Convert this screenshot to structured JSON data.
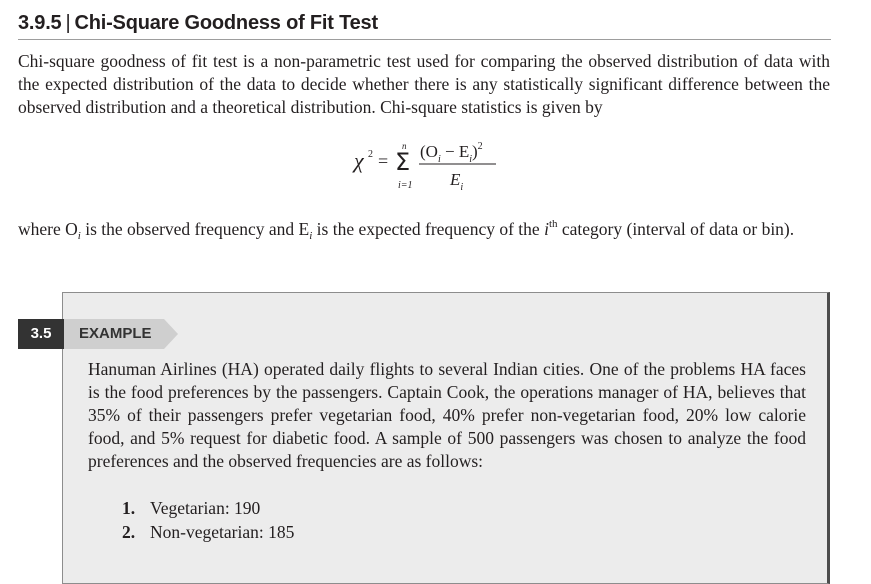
{
  "section": {
    "number": "3.9.5",
    "separator": "|",
    "title": "Chi-Square Goodness of Fit Test"
  },
  "intro_paragraph": "Chi-square goodness of fit test is a non-parametric test used for comparing the observed distribution of data with the expected distribution of the data to decide whether there is any statistically significant difference between the observed distribution and a theoretical distribution. Chi-square statistics is given by",
  "formula": {
    "lhs": "χ",
    "lhs_power": "2",
    "equals": "=",
    "sum_symbol": "Σ",
    "sum_upper": "n",
    "sum_lower": "i=1",
    "numerator": "(O",
    "numerator_sub1": "i",
    "numerator_mid": " − E",
    "numerator_sub2": "i",
    "numerator_close": ")",
    "numerator_power": "2",
    "denominator": "E",
    "denominator_sub": "i"
  },
  "where_paragraph": {
    "part1": "where O",
    "sub1": "i",
    "part2": " is the observed frequency and E",
    "sub2": "i",
    "part3": " is the expected frequency of the ",
    "i": "i",
    "th": "th",
    "part4": " category (interval of data or bin)."
  },
  "example": {
    "number": "3.5",
    "label": "EXAMPLE",
    "text": "Hanuman Airlines (HA) operated daily flights to several Indian cities. One of the problems HA faces is the food preferences by the passengers. Captain Cook, the operations manager of HA, believes that 35% of their passengers prefer vegetarian food, 40% prefer non-vegetarian food, 20% low calorie food, and 5% request for diabetic food. A sample of 500 passengers was chosen to analyze the food preferences and the observed frequencies are as follows:",
    "items": [
      {
        "num": "1.",
        "text": "Vegetarian: 190"
      },
      {
        "num": "2.",
        "text": "Non-vegetarian: 185"
      }
    ]
  },
  "colors": {
    "text": "#231f20",
    "box_fill": "#ececec",
    "badge_dark": "#333333",
    "badge_light": "#cfcfcf"
  }
}
